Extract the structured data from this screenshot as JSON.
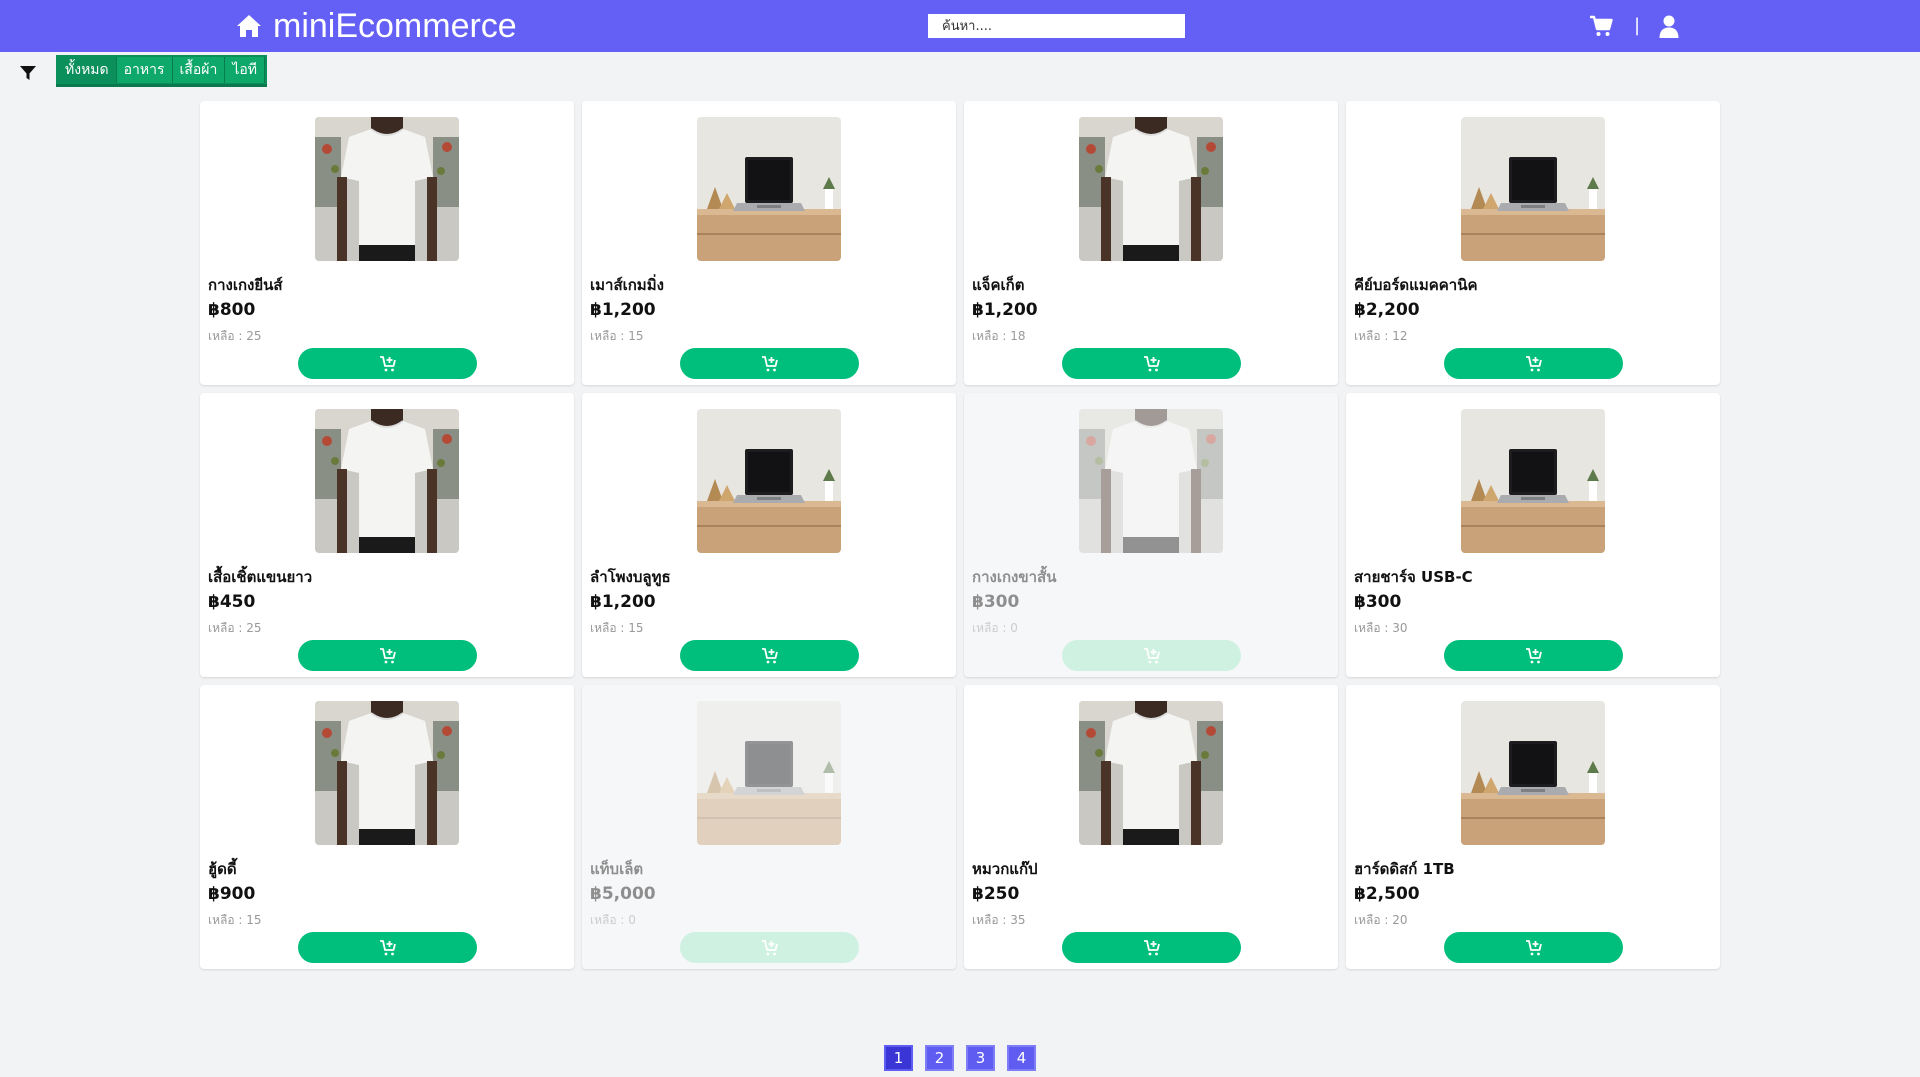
{
  "app": {
    "brand": "miniEcommerce",
    "brand_color": "#6460f5",
    "accent_green": "#00be7c"
  },
  "search": {
    "placeholder": "ค้นหา...."
  },
  "header_icons": {
    "cart": "cart-icon",
    "separator": "|",
    "user": "user-icon"
  },
  "filter": {
    "icon": "filter-icon",
    "categories": [
      {
        "label": "ทั้งหมด",
        "active": true
      },
      {
        "label": "อาหาร",
        "active": false
      },
      {
        "label": "เสื้อผ้า",
        "active": false
      },
      {
        "label": "ไอที",
        "active": false
      }
    ]
  },
  "stock_prefix": "เหลือ : ",
  "products": [
    {
      "name": "กางเกงยีนส์",
      "price": "฿800",
      "stock": "25",
      "image": "tshirt",
      "available": true
    },
    {
      "name": "เมาส์เกมมิ่ง",
      "price": "฿1,200",
      "stock": "15",
      "image": "laptop",
      "available": true
    },
    {
      "name": "แจ็คเก็ต",
      "price": "฿1,200",
      "stock": "18",
      "image": "tshirt",
      "available": true
    },
    {
      "name": "คีย์บอร์ดแมคคานิค",
      "price": "฿2,200",
      "stock": "12",
      "image": "laptop",
      "available": true
    },
    {
      "name": "เสื้อเชิ้ตแขนยาว",
      "price": "฿450",
      "stock": "25",
      "image": "tshirt",
      "available": true
    },
    {
      "name": "ลำโพงบลูทูธ",
      "price": "฿1,200",
      "stock": "15",
      "image": "laptop",
      "available": true
    },
    {
      "name": "กางเกงขาสั้น",
      "price": "฿300",
      "stock": "0",
      "image": "tshirt",
      "available": false
    },
    {
      "name": "สายชาร์จ USB-C",
      "price": "฿300",
      "stock": "30",
      "image": "laptop",
      "available": true
    },
    {
      "name": "ฮู้ดดี้",
      "price": "฿900",
      "stock": "15",
      "image": "tshirt",
      "available": true
    },
    {
      "name": "แท็บเล็ต",
      "price": "฿5,000",
      "stock": "0",
      "image": "laptop",
      "available": false
    },
    {
      "name": "หมวกแก๊ป",
      "price": "฿250",
      "stock": "35",
      "image": "tshirt",
      "available": true
    },
    {
      "name": "ฮาร์ดดิสก์ 1TB",
      "price": "฿2,500",
      "stock": "20",
      "image": "laptop",
      "available": true
    }
  ],
  "pagination": {
    "pages": [
      "1",
      "2",
      "3",
      "4"
    ],
    "current": "1"
  }
}
